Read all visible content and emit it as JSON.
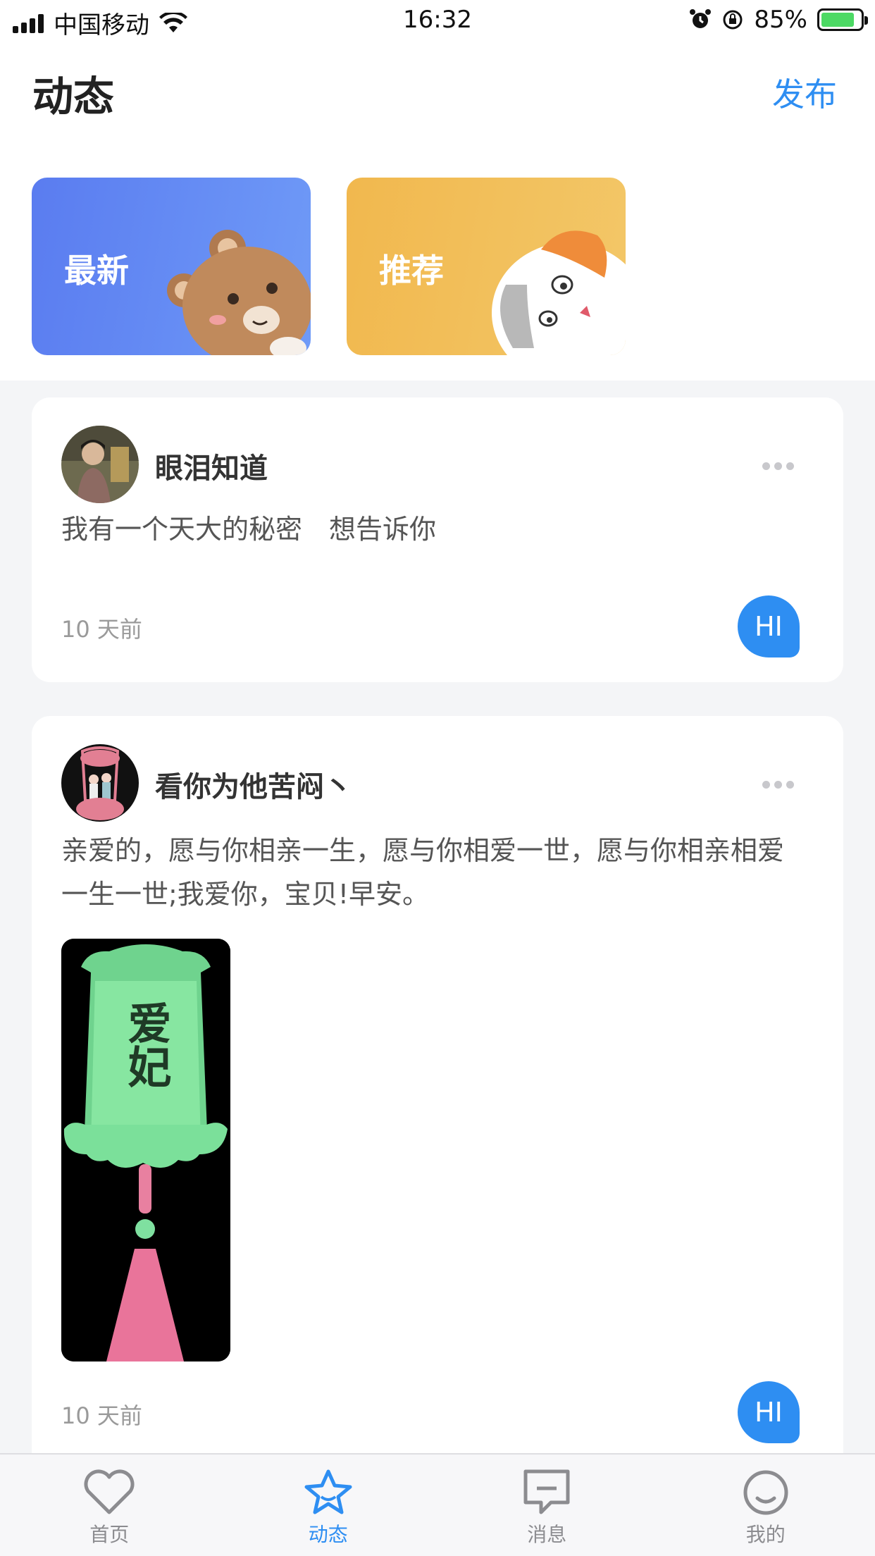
{
  "status_bar": {
    "carrier": "中国移动",
    "time": "16:32",
    "battery": "85%",
    "battery_level": 0.85
  },
  "header": {
    "title": "动态",
    "publish_label": "发布"
  },
  "categories": [
    {
      "label": "最新",
      "color": "#5a7cf0",
      "mascot": "bear-icon"
    },
    {
      "label": "推荐",
      "color": "#f1b84e",
      "mascot": "cat-icon"
    }
  ],
  "posts": [
    {
      "username": "眼泪知道",
      "text": "我有一个天大的秘密　想告诉你",
      "time": "10 天前",
      "action": "HI"
    },
    {
      "username": "看你为他苦闷丶",
      "text": "亲爱的，愿与你相亲一生，愿与你相爱一世，愿与你相亲相爱一生一世;我爱你，宝贝!早安。",
      "time": "10 天前",
      "action": "HI",
      "image_text": "爱妃"
    }
  ],
  "tabs": [
    {
      "label": "首页",
      "icon": "heart-icon",
      "active": false
    },
    {
      "label": "动态",
      "icon": "star-icon",
      "active": true
    },
    {
      "label": "消息",
      "icon": "message-icon",
      "active": false
    },
    {
      "label": "我的",
      "icon": "profile-icon",
      "active": false
    }
  ],
  "colors": {
    "accent": "#2e8ef2",
    "page_bg": "#f4f5f7"
  }
}
